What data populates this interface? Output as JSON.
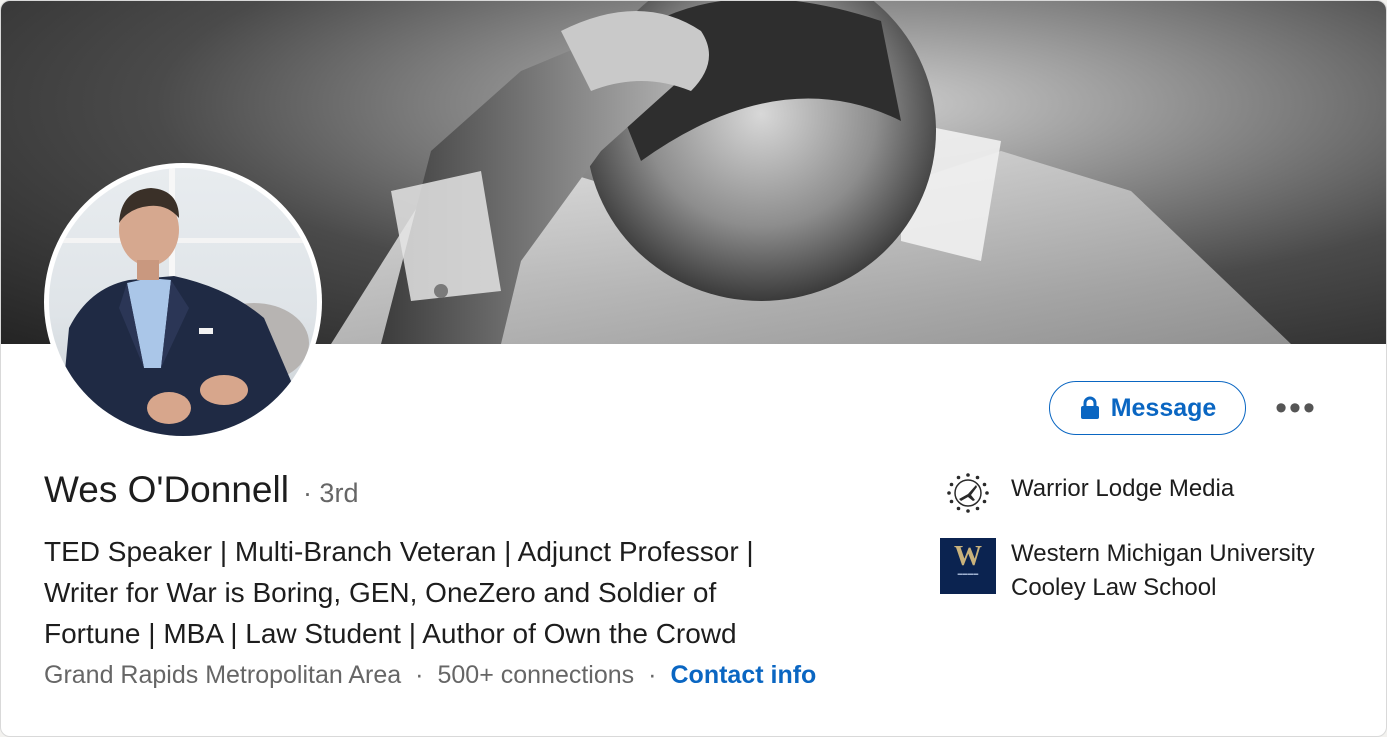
{
  "profile": {
    "name": "Wes O'Donnell",
    "degree": "· 3rd",
    "headline_lines": [
      "TED Speaker | Multi-Branch Veteran | Adjunct Professor |",
      "Writer for War is Boring, GEN, OneZero and Soldier of",
      "Fortune | MBA | Law Student | Author of Own the Crowd"
    ],
    "location": "Grand Rapids Metropolitan Area",
    "connections": "500+ connections",
    "contact_info_label": "Contact info",
    "meta_separator": "·"
  },
  "actions": {
    "message_label": "Message",
    "more_label": "•••"
  },
  "organizations": [
    {
      "name": "Warrior Lodge Media",
      "logo": "star-ring-jet-icon"
    },
    {
      "name": "Western Michigan University Cooley Law School",
      "logo": "wmu-w-logo",
      "logo_letter": "W"
    }
  ],
  "colors": {
    "primary_blue": "#0a66c2",
    "text_dark": "#1d1d1d",
    "text_muted": "#666666",
    "wmu_navy": "#0b2350",
    "wmu_gold": "#c9b27c"
  }
}
